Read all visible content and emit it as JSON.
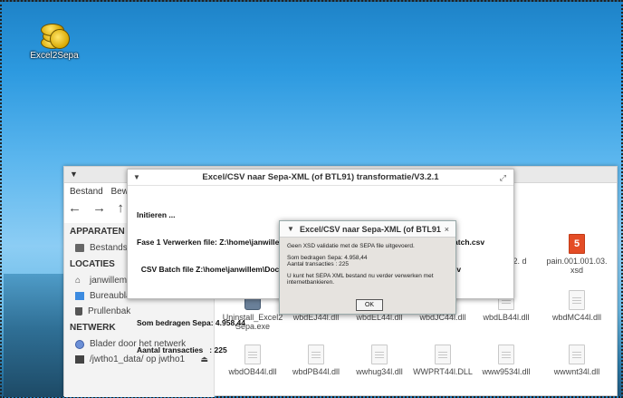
{
  "desktop": {
    "icon_label": "Excel2Sepa"
  },
  "file_manager": {
    "menu": [
      "Bestand",
      "Bewe"
    ],
    "nav": {
      "back": "←",
      "forward": "→",
      "up": "↑"
    },
    "sidebar": {
      "sections": [
        {
          "heading": "APPARATEN",
          "items": [
            {
              "label": "Bestandss",
              "icon": "drive-icon"
            }
          ]
        },
        {
          "heading": "LOCATIES",
          "items": [
            {
              "label": "janwillem",
              "icon": "home-icon"
            },
            {
              "label": "Bureaublad",
              "icon": "desktop-folder-icon"
            },
            {
              "label": "Prullenbak",
              "icon": "trash-icon"
            }
          ]
        },
        {
          "heading": "NETWERK",
          "items": [
            {
              "label": "Blader door het netwerk",
              "icon": "network-icon"
            },
            {
              "label": "/jwtho1_data/ op jwtho1",
              "icon": "share-icon"
            }
          ]
        }
      ],
      "eject": "⏏"
    },
    "files": [
      {
        "name": "...001.02. d",
        "icon": "html5-icon"
      },
      {
        "name": "pain.001.001.03. xsd",
        "icon": "html5-icon"
      },
      {
        "name": "Uninstall_Excel2 Sepa.exe",
        "icon": "exe-icon"
      },
      {
        "name": "wbdEJ44l.dll",
        "icon": "file-icon"
      },
      {
        "name": "wbdEL44l.dll",
        "icon": "file-icon"
      },
      {
        "name": "wbdJC44l.dll",
        "icon": "file-icon"
      },
      {
        "name": "wbdLB44l.dll",
        "icon": "file-icon"
      },
      {
        "name": "wbdMC44l.dll",
        "icon": "file-icon"
      },
      {
        "name": "wbdOB44l.dll",
        "icon": "file-icon"
      },
      {
        "name": "wbdPB44l.dll",
        "icon": "file-icon"
      },
      {
        "name": "wwhug34l.dll",
        "icon": "file-icon"
      },
      {
        "name": "WWPRT44l.DLL",
        "icon": "file-icon"
      },
      {
        "name": "www9534l.dll",
        "icon": "file-icon"
      },
      {
        "name": "wwwnt34l.dll",
        "icon": "file-icon"
      }
    ]
  },
  "main_dialog": {
    "title": "Excel/CSV naar Sepa-XML (of BTL91) transformatie/V3.2.1",
    "lines": [
      "Initieren ...",
      "Fase 1 Verwerken file: Z:\\home\\janwillem\\Documenten\\Incasso2Zomerschool2017testbatch.csv",
      "  CSV Batch file Z:\\home\\janwillem\\Documenten\\Incasso2Zomerschool2017testbatch.csv",
      "",
      "Som bedragen Sepa: 4.958,44",
      "Aantal transacties   : 225"
    ]
  },
  "sub_dialog": {
    "title": "Excel/CSV naar Sepa-XML (of BTL91",
    "close": "×",
    "line1": "Geen XSD validatie met de SEPA file uitgevoerd.",
    "line2": "Som bedragen Sepa: 4.958,44",
    "line3": "Aantal transacties   : 225",
    "line4": "U kunt het SEPA XML bestand nu verder verwerken met internetbankieren.",
    "ok": "OK"
  }
}
